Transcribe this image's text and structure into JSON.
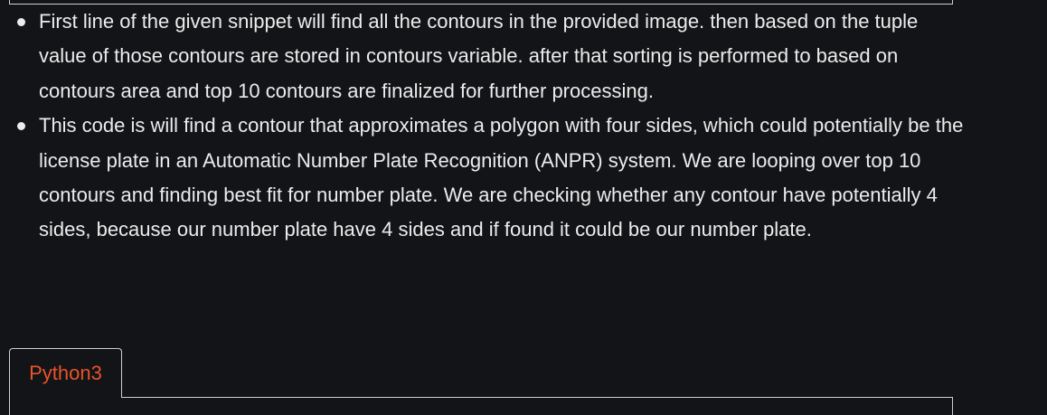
{
  "bullets": [
    "First line of the given snippet will find all the contours in the provided image. then based on the tuple value of those contours are stored in contours variable. after that sorting is performed to based on contours area and top 10 contours are finalized for further processing.",
    "This code is will find a contour that approximates a polygon with four sides, which could potentially be the license plate in an Automatic Number Plate Recognition (ANPR) system. We are looping over top 10 contours and finding best fit for number plate. We are checking whether any contour have potentially 4 sides, because our number plate have 4 sides and if found it could be our number plate."
  ],
  "code_tabs": {
    "active_label": "Python3"
  },
  "colors": {
    "background": "#131417",
    "text": "#ececec",
    "tab_active": "#e8532a",
    "border": "#cfcfcf"
  }
}
